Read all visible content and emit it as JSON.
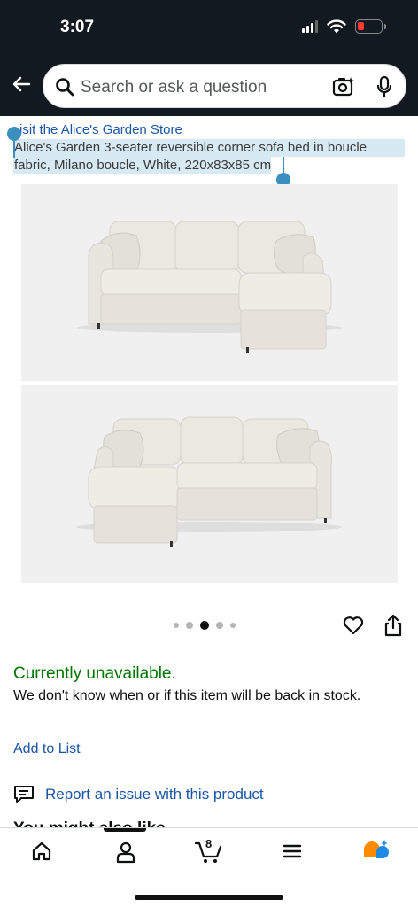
{
  "status_bar": {
    "time": "3:07"
  },
  "search": {
    "placeholder": "Search or ask a question"
  },
  "product": {
    "store_link": "isit the Alice's Garden Store",
    "title_line1": "Alice's Garden 3-seater reversible corner sofa bed in boucle",
    "title_line2": "fabric, Milano boucle, White, 220x83x85 cm",
    "images_count": 5,
    "active_image_index": 2
  },
  "availability": {
    "status": "Currently unavailable.",
    "note": "We don't know when or if this item will be back in stock."
  },
  "actions": {
    "add_to_list": "Add to List",
    "report_issue": "Report an issue with this product"
  },
  "next_section_peek": "You might also like",
  "bottom_nav": {
    "items": [
      "home-icon",
      "account-icon",
      "cart-icon",
      "menu-icon",
      "assistant-icon"
    ],
    "cart_count": "8"
  },
  "colors": {
    "header_bg": "#131921",
    "link": "#1a55a6",
    "available_green": "#007600",
    "selection": "#d7e9f3"
  }
}
